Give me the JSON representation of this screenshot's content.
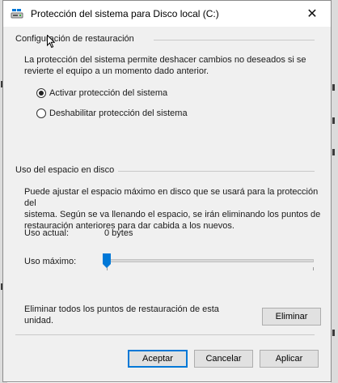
{
  "window": {
    "title": "Protección del sistema para Disco local (C:)",
    "close_glyph": "✕"
  },
  "restore_settings": {
    "group_title": "Configuración de restauración",
    "description_line1": "La protección del sistema permite deshacer cambios no deseados si se",
    "description_line2": "revierte el equipo a un momento dado anterior.",
    "options": [
      {
        "label": "Activar protección del sistema",
        "selected": true
      },
      {
        "label": "Deshabilitar protección del sistema",
        "selected": false
      }
    ]
  },
  "disk_usage": {
    "group_title": "Uso del espacio en disco",
    "description_line1": "Puede ajustar el espacio máximo en disco que se usará para la protección del",
    "description_line2": "sistema. Según se va llenando el espacio, se irán eliminando los puntos de",
    "description_line3": "restauración anteriores para dar cabida a los nuevos.",
    "current_usage_label": "Uso actual:",
    "current_usage_value": "0 bytes",
    "max_usage_label": "Uso máximo:",
    "max_usage_level": 0
  },
  "delete_points": {
    "text_line1": "Eliminar todos los puntos de restauración de esta",
    "text_line2": "unidad.",
    "button_label": "Eliminar"
  },
  "footer": {
    "accept_label": "Aceptar",
    "cancel_label": "Cancelar",
    "apply_label": "Aplicar"
  },
  "colors": {
    "accent": "#0078d7",
    "content_bg": "#f0f0f0"
  }
}
